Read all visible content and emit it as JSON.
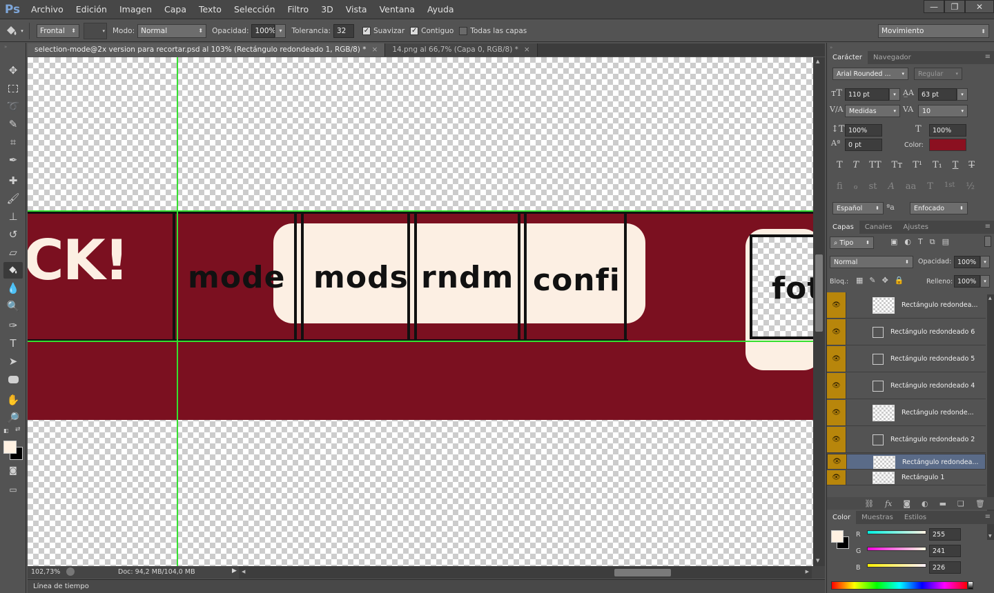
{
  "app": {
    "logo": "Ps"
  },
  "menu": [
    "Archivo",
    "Edición",
    "Imagen",
    "Capa",
    "Texto",
    "Selección",
    "Filtro",
    "3D",
    "Vista",
    "Ventana",
    "Ayuda"
  ],
  "window_controls": {
    "minimize": "—",
    "restore": "❐",
    "close": "✕"
  },
  "options": {
    "tool_icon": "paint-bucket-icon",
    "fill_source": "Frontal",
    "pattern": "",
    "mode_label": "Modo:",
    "mode": "Normal",
    "opacity_label": "Opacidad:",
    "opacity": "100%",
    "tolerance_label": "Tolerancia:",
    "tolerance": "32",
    "smooth": "Suavizar",
    "contiguous": "Contiguo",
    "all_layers": "Todas las capas",
    "workspace": "Movimiento"
  },
  "tabs": [
    {
      "label": "selection-mode@2x version para recortar.psd al 103% (Rectángulo redondeado 1, RGB/8) *",
      "close": "×"
    },
    {
      "label": "14.png al 66,7% (Capa 0, RGB/8) *",
      "close": "×"
    }
  ],
  "canvas": {
    "ck_text": "CK!",
    "words": [
      "mode",
      "mods",
      "rndm",
      "confi",
      "fot"
    ],
    "band_color": "#7b1020",
    "cream_color": "#fcefe3",
    "guide_color": "#34e02f"
  },
  "status": {
    "zoom": "102,73%",
    "doc": "Doc: 94,2 MB/104,0 MB"
  },
  "timeline": "Línea de tiempo",
  "character": {
    "tabs": [
      "Carácter",
      "Navegador"
    ],
    "font_family": "Arial Rounded ...",
    "font_style": "Regular",
    "size": "110 pt",
    "leading": "63 pt",
    "kerning": "Medidas",
    "tracking": "10",
    "vscale": "100%",
    "hscale": "100%",
    "baseline": "0 pt",
    "color_label": "Color:",
    "color": "#8b1020",
    "style_buttons": [
      "T",
      "T",
      "TT",
      "Tт",
      "T¹",
      "T₁",
      "T",
      "T"
    ],
    "opentype_buttons": [
      "ﬁ",
      "ℴ",
      "st",
      "A",
      "aa",
      "T",
      "1st",
      "½"
    ],
    "language": "Español",
    "aa_icon": "ªa",
    "antialias": "Enfocado"
  },
  "layers": {
    "tabs": [
      "Capas",
      "Canales",
      "Ajustes"
    ],
    "filter": "Tipo",
    "blend": "Normal",
    "opacity_label": "Opacidad:",
    "opacity": "100%",
    "lock_label": "Bloq.:",
    "fill_label": "Relleno:",
    "fill": "100%",
    "items": [
      {
        "name": "Rectángulo redondea...",
        "kind": "thumb"
      },
      {
        "name": "Rectángulo redondeado 6",
        "kind": "shape"
      },
      {
        "name": "Rectángulo redondeado 5",
        "kind": "shape"
      },
      {
        "name": "Rectángulo redondeado 4",
        "kind": "shape"
      },
      {
        "name": "Rectángulo redonde...",
        "kind": "thumb"
      },
      {
        "name": "Rectángulo redondeado 2",
        "kind": "shape"
      },
      {
        "name": "Rectángulo redondea...",
        "kind": "thumb",
        "selected": true
      },
      {
        "name": "Rectángulo 1",
        "kind": "thumb"
      }
    ],
    "footer_icons": [
      "link-icon",
      "fx-icon",
      "mask-icon",
      "adjustment-icon",
      "folder-icon",
      "new-layer-icon",
      "trash-icon"
    ]
  },
  "color_panel": {
    "tabs": [
      "Color",
      "Muestras",
      "Estilos"
    ],
    "r_label": "R",
    "r": "255",
    "g_label": "G",
    "g": "241",
    "b_label": "B",
    "b": "226",
    "foreground": "#fff1e2"
  }
}
